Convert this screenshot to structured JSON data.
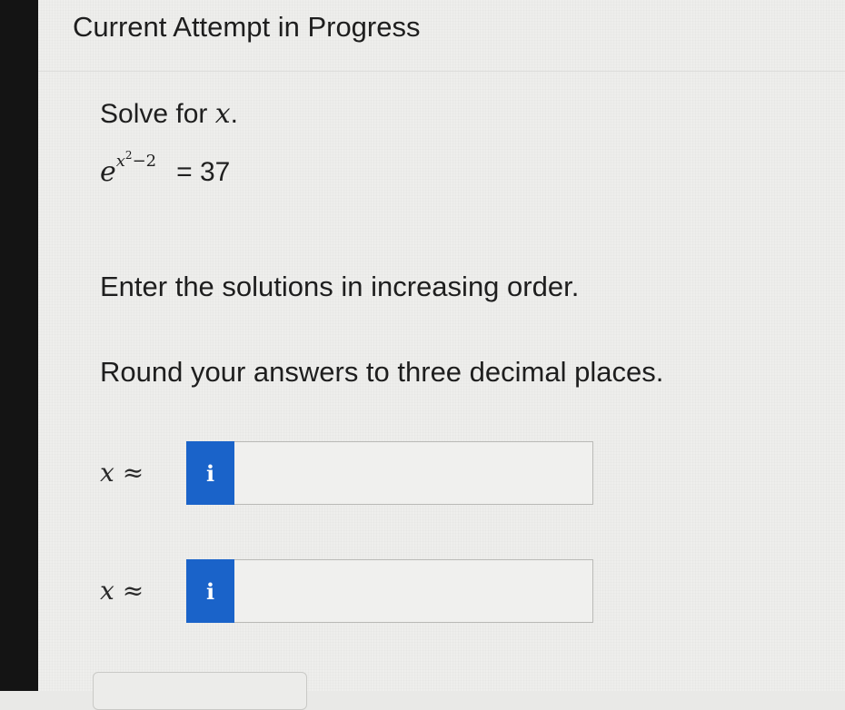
{
  "header": {
    "title": "Current Attempt in Progress"
  },
  "question": {
    "prompt_text": "Solve for ",
    "prompt_var": "x",
    "prompt_end": ".",
    "equation": {
      "base": "e",
      "exponent_var": "x",
      "exponent_power": "2",
      "exponent_rest": "−2",
      "rhs": "= 37"
    },
    "instruction_order": "Enter the solutions in increasing order.",
    "instruction_round": "Round your answers to three decimal places."
  },
  "answers": [
    {
      "var": "x",
      "symbol": "≈",
      "info_label": "i",
      "value": ""
    },
    {
      "var": "x",
      "symbol": "≈",
      "info_label": "i",
      "value": ""
    }
  ],
  "colors": {
    "info_button": "#1a63c9",
    "page_background": "#eeeeec",
    "left_frame": "#141414"
  },
  "icons": {
    "info": "info-icon"
  }
}
